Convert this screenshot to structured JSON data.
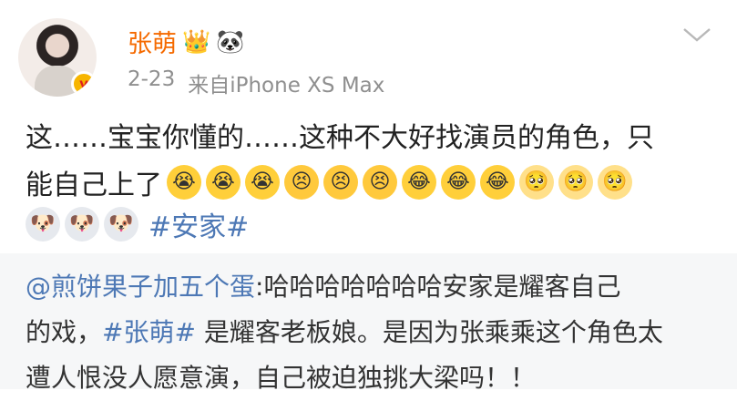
{
  "post": {
    "author": "张萌",
    "date": "2-23",
    "source": "来自iPhone XS Max",
    "text_line1": "这……宝宝你懂的……这种不大好找演员的角色，只",
    "text_line2": "能自己上了",
    "emojis_line2": [
      "cry-face-icon",
      "cry-face-icon",
      "cry-face-icon",
      "sad-face-icon",
      "sad-face-icon",
      "sad-face-icon",
      "laugh-cry-icon",
      "laugh-cry-icon",
      "laugh-cry-icon",
      "pity-face-icon",
      "pity-face-icon",
      "pity-face-icon"
    ],
    "emojis_line3": [
      "husky-dog-icon",
      "husky-dog-icon",
      "husky-dog-icon"
    ],
    "hashtag": "#安家#"
  },
  "repost": {
    "mention": "@煎饼果子加五个蛋",
    "line1_rest": ":哈哈哈哈哈哈哈安家是耀客自己",
    "line2_pre": "的戏，",
    "line2_tag": "#张萌#",
    "line2_rest": " 是耀客老板娘。是因为张乘乘这个角色太",
    "line3": "遭人恨没人愿意演，自己被迫独挑大梁吗！！"
  },
  "colors": {
    "username": "#f56a00",
    "link": "#4d78b5",
    "meta": "#8f8f8f",
    "repost_bg": "#f6f7f8"
  }
}
